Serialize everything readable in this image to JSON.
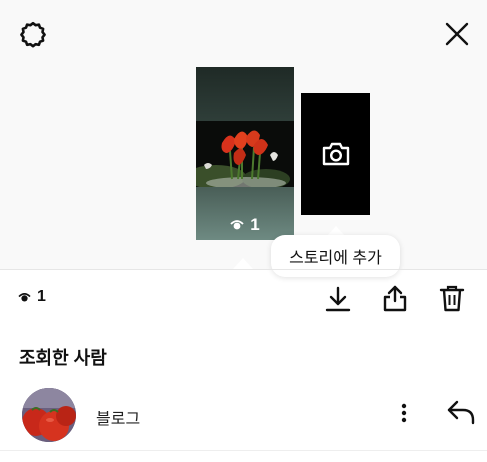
{
  "header": {
    "settings_icon": "gear-icon",
    "close_icon": "close-icon"
  },
  "story": {
    "thumbnail_view_count": "1",
    "add_story_icon": "camera-icon",
    "add_story_tooltip": "스토리에 추가"
  },
  "toolbar": {
    "view_count": "1",
    "download_icon": "download-icon",
    "share_icon": "share-icon",
    "delete_icon": "trash-icon"
  },
  "viewers": {
    "title": "조회한 사람",
    "items": [
      {
        "name": "블로그",
        "more_icon": "more-vertical-icon",
        "reply_icon": "reply-icon"
      }
    ]
  },
  "colors": {
    "background": "#f9f9f9",
    "card": "#000000",
    "text": "#111111"
  }
}
